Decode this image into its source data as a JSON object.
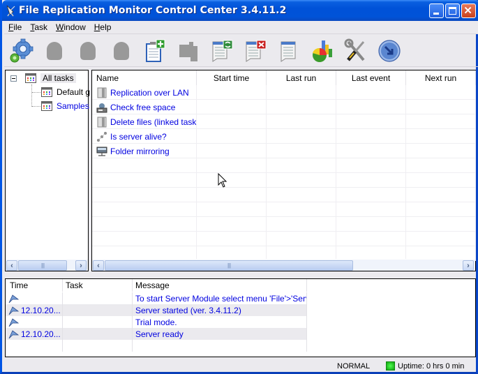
{
  "window": {
    "title": "File Replication Monitor Control Center 3.4.11.2",
    "controls": [
      "minimize",
      "maximize",
      "close"
    ]
  },
  "menubar": {
    "items": [
      {
        "label": "File",
        "mnemonic": "F",
        "rest": "ile"
      },
      {
        "label": "Task",
        "mnemonic": "T",
        "rest": "ask"
      },
      {
        "label": "Window",
        "mnemonic": "W",
        "rest": "indow"
      },
      {
        "label": "Help",
        "mnemonic": "H",
        "rest": "elp"
      }
    ]
  },
  "toolbar": {
    "buttons": [
      {
        "name": "settings-gear",
        "enabled": true
      },
      {
        "name": "disabled-1",
        "enabled": false
      },
      {
        "name": "disabled-2",
        "enabled": false
      },
      {
        "name": "disabled-3",
        "enabled": false
      },
      {
        "name": "new-task",
        "enabled": true
      },
      {
        "name": "disabled-4",
        "enabled": false
      },
      {
        "name": "refresh-task",
        "enabled": true
      },
      {
        "name": "delete-task",
        "enabled": true
      },
      {
        "name": "task-properties",
        "enabled": true
      },
      {
        "name": "statistics",
        "enabled": true
      },
      {
        "name": "tools",
        "enabled": true
      },
      {
        "name": "exit",
        "enabled": true
      }
    ]
  },
  "tree": {
    "root": {
      "label": "All tasks",
      "expanded": true,
      "selected": true
    },
    "children": [
      {
        "label": "Default g",
        "color": "#000000"
      },
      {
        "label": "Samples",
        "color": "#0000e0"
      }
    ]
  },
  "task_list": {
    "columns": [
      "Name",
      "Start time",
      "Last run",
      "Last event",
      "Next run"
    ],
    "rows": [
      {
        "name": "Replication over LAN",
        "icon": "replication-icon",
        "start_time": "",
        "last_run": "",
        "last_event": "",
        "next_run": ""
      },
      {
        "name": "Check free space",
        "icon": "disk-check-icon",
        "start_time": "",
        "last_run": "",
        "last_event": "",
        "next_run": ""
      },
      {
        "name": "Delete files (linked task)",
        "icon": "delete-files-icon",
        "start_time": "",
        "last_run": "",
        "last_event": "",
        "next_run": ""
      },
      {
        "name": "Is server alive?",
        "icon": "ping-icon",
        "start_time": "",
        "last_run": "",
        "last_event": "",
        "next_run": ""
      },
      {
        "name": "Folder mirroring",
        "icon": "network-folder-icon",
        "start_time": "",
        "last_run": "",
        "last_event": "",
        "next_run": ""
      }
    ]
  },
  "log": {
    "columns": [
      "Time",
      "Task",
      "Message"
    ],
    "rows": [
      {
        "time": "",
        "task": "",
        "message": "To start Server Module select menu 'File'>'Serve..."
      },
      {
        "time": "12.10.20...",
        "task": "",
        "message": "Server started (ver. 3.4.11.2)"
      },
      {
        "time": "",
        "task": "",
        "message": "Trial mode."
      },
      {
        "time": "12.10.20...",
        "task": "",
        "message": "Server ready"
      }
    ]
  },
  "statusbar": {
    "mode": "NORMAL",
    "uptime": "Uptime: 0 hrs 0 min",
    "status_color": "#22cc22"
  },
  "colors": {
    "titlebar": "#0053d8",
    "link": "#0000e0"
  }
}
